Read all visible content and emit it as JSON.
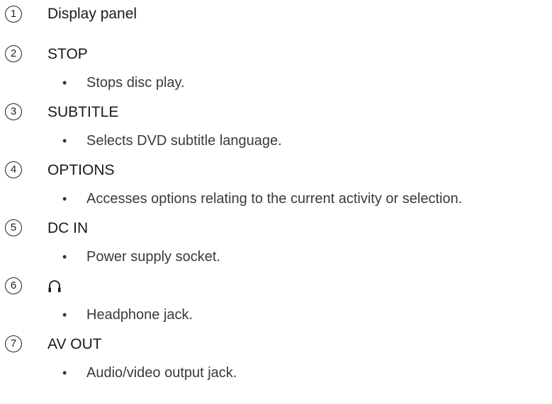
{
  "items": [
    {
      "number": "1",
      "title": "Display panel",
      "description": ""
    },
    {
      "number": "2",
      "title": "STOP",
      "description": "Stops disc play."
    },
    {
      "number": "3",
      "title": "SUBTITLE",
      "description": "Selects DVD subtitle language."
    },
    {
      "number": "4",
      "title": "OPTIONS",
      "description": "Accesses options relating to the current activity or selection."
    },
    {
      "number": "5",
      "title": "DC IN",
      "description": "Power supply socket."
    },
    {
      "number": "6",
      "title": "",
      "title_icon": "headphone-icon",
      "description": "Headphone jack."
    },
    {
      "number": "7",
      "title": "AV OUT",
      "description": "Audio/video output jack."
    }
  ],
  "bullet_symbol": "•",
  "colors": {
    "text": "#1f1f1f",
    "description": "#3a3a3a"
  }
}
